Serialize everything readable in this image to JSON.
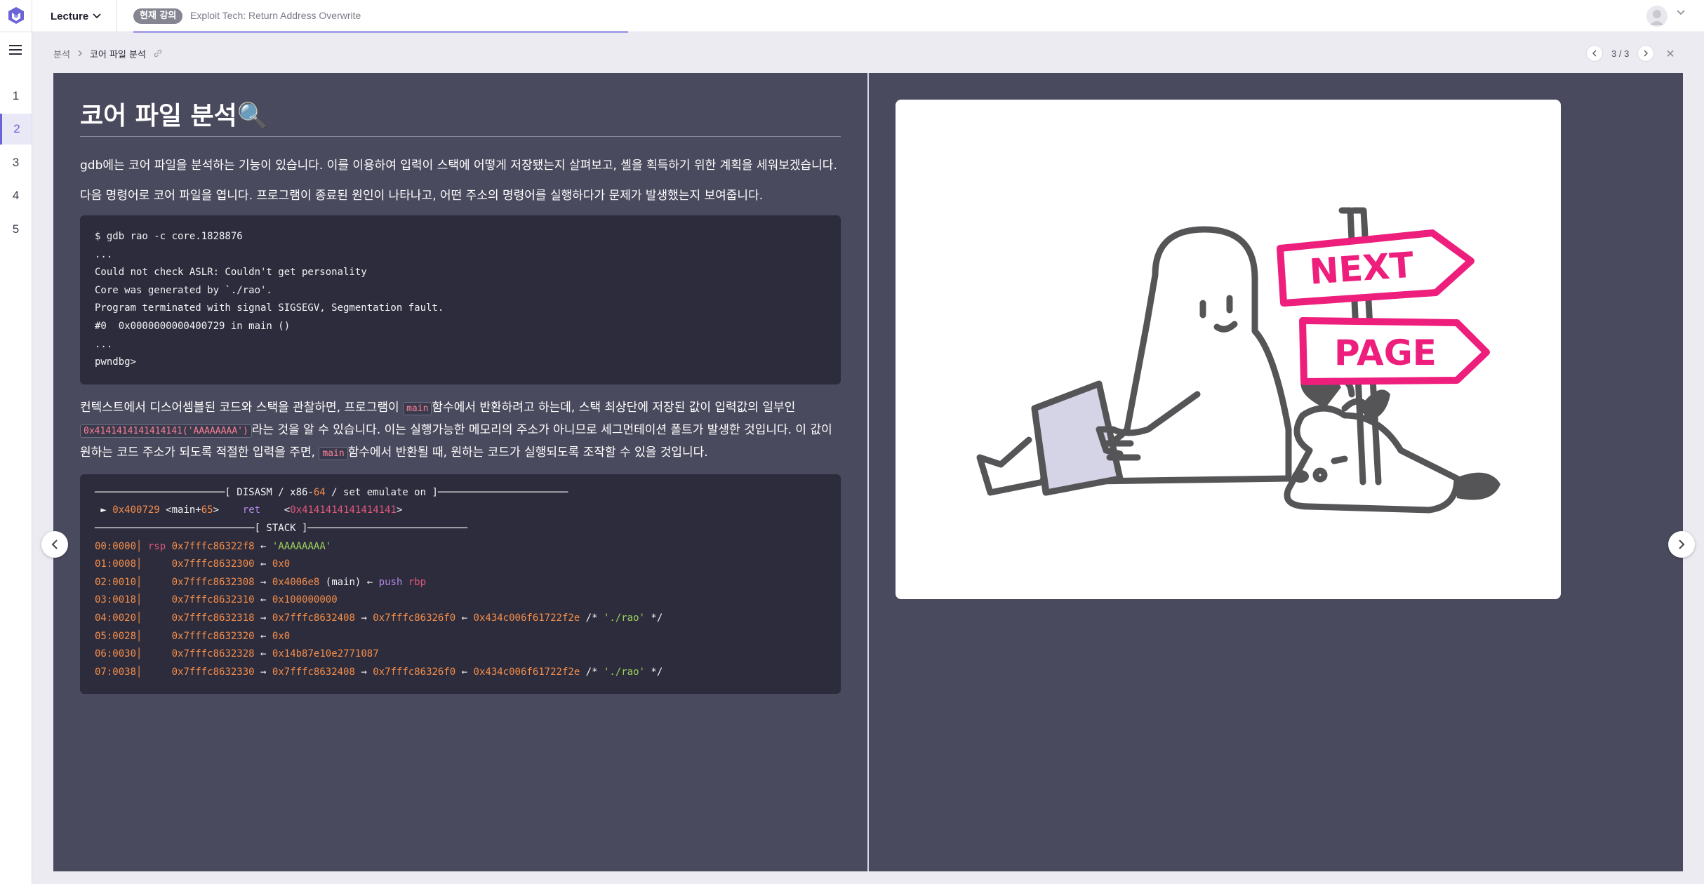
{
  "topbar": {
    "menu_label": "Lecture",
    "current_badge": "현재 강의",
    "course_title": "Exploit Tech: Return Address Overwrite",
    "progress_fraction": 0.45
  },
  "leftnav": {
    "items": [
      "1",
      "2",
      "3",
      "4",
      "5"
    ],
    "active_index": 1
  },
  "breadcrumb": {
    "parent": "분석",
    "current": "코어 파일 분석"
  },
  "pager": {
    "text": "3 / 3"
  },
  "slide": {
    "title": "코어 파일 분석🔍",
    "para1": "gdb에는 코어 파일을 분석하는 기능이 있습니다. 이를 이용하여 입력이 스택에 어떻게 저장됐는지 살펴보고, 셸을 획득하기 위한 계획을 세워보겠습니다.",
    "para2": "다음 명령어로 코어 파일을 엽니다. 프로그램이 종료된 원인이 나타나고, 어떤 주소의 명령어를 실행하다가 문제가 발생했는지 보여줍니다.",
    "code1": [
      "$ gdb rao -c core.1828876",
      "...",
      "Could not check ASLR: Couldn't get personality",
      "Core was generated by `./rao'.",
      "Program terminated with signal SIGSEGV, Segmentation fault.",
      "#0  0x0000000000400729 in main ()",
      "...",
      "pwndbg>"
    ],
    "para3": {
      "t1": "컨텍스트에서 디스어셈블된 코드와 스택을 관찰하면, 프로그램이 ",
      "c1": "main",
      "t2": "함수에서 반환하려고 하는데, 스택 최상단에 저장된 값이 입력값의 일부인 ",
      "c2": "0x4141414141414141('AAAAAAAA')",
      "t3": "라는 것을 알 수 있습니다. 이는 실행가능한 메모리의 주소가 아니므로 세그먼테이션 폴트가 발생한 것입니다. 이 값이 원하는 코드 주소가 되도록 적절한 입력을 주면, ",
      "c3": "main",
      "t4": "함수에서 반환될 때, 원하는 코드가 실행되도록 조작할 수 있을 것입니다."
    },
    "code2": {
      "disasm_header": {
        "left": "──────────────────────[ DISASM / x86-",
        "num": "64",
        "right": " / set emulate on ]──────────────────────"
      },
      "disasm_line": {
        "arrow": " ► ",
        "addr": "0x400729",
        "sym": " <main+",
        "off": "65",
        "sym_end": ">",
        "gap": "    ",
        "op": "ret",
        "gap2": "    <",
        "target": "0x4141414141414141",
        "end": ">"
      },
      "stack_header": "───────────────────────────[ STACK ]───────────────────────────",
      "stack_rows": [
        {
          "idx": "00:0000│",
          "reg": " rsp ",
          "addr": "0x7fffc86322f8",
          "arrow": " ← ",
          "val": "'AAAAAAAA'",
          "val_class": "c-green",
          "rest": []
        },
        {
          "idx": "01:0008│",
          "reg": "     ",
          "addr": "0x7fffc8632300",
          "arrow": " ← ",
          "val": "0x0",
          "val_class": "c-orange",
          "rest": []
        },
        {
          "idx": "02:0010│",
          "reg": "     ",
          "addr": "0x7fffc8632308",
          "arrow": " → ",
          "val": "0x4006e8",
          "val_class": "c-orange",
          "rest": [
            {
              "t": " (main)",
              "c": "c-white"
            },
            {
              "t": " ← ",
              "c": "c-white"
            },
            {
              "t": "push",
              "c": "c-purple"
            },
            {
              "t": " rbp",
              "c": "c-pink"
            }
          ]
        },
        {
          "idx": "03:0018│",
          "reg": "     ",
          "addr": "0x7fffc8632310",
          "arrow": " ← ",
          "val": "0x100000000",
          "val_class": "c-orange",
          "rest": []
        },
        {
          "idx": "04:0020│",
          "reg": "     ",
          "addr": "0x7fffc8632318",
          "arrow": " → ",
          "val": "0x7fffc8632408",
          "val_class": "c-orange",
          "rest": [
            {
              "t": " → ",
              "c": "c-white"
            },
            {
              "t": "0x7fffc86326f0",
              "c": "c-orange"
            },
            {
              "t": " ← ",
              "c": "c-white"
            },
            {
              "t": "0x434c006f61722f2e",
              "c": "c-orange"
            },
            {
              "t": " /* ",
              "c": "c-white"
            },
            {
              "t": "'./rao'",
              "c": "c-green"
            },
            {
              "t": " */",
              "c": "c-white"
            }
          ]
        },
        {
          "idx": "05:0028│",
          "reg": "     ",
          "addr": "0x7fffc8632320",
          "arrow": " ← ",
          "val": "0x0",
          "val_class": "c-orange",
          "rest": []
        },
        {
          "idx": "06:0030│",
          "reg": "     ",
          "addr": "0x7fffc8632328",
          "arrow": " ← ",
          "val": "0x14b87e10e2771087",
          "val_class": "c-orange",
          "rest": []
        },
        {
          "idx": "07:0038│",
          "reg": "     ",
          "addr": "0x7fffc8632330",
          "arrow": " → ",
          "val": "0x7fffc8632408",
          "val_class": "c-orange",
          "rest": [
            {
              "t": " → ",
              "c": "c-white"
            },
            {
              "t": "0x7fffc86326f0",
              "c": "c-orange"
            },
            {
              "t": " ← ",
              "c": "c-white"
            },
            {
              "t": "0x434c006f61722f2e",
              "c": "c-orange"
            },
            {
              "t": " /* ",
              "c": "c-white"
            },
            {
              "t": "'./rao'",
              "c": "c-green"
            },
            {
              "t": " */",
              "c": "c-white"
            }
          ]
        }
      ]
    }
  },
  "illustration": {
    "sign_top": "NEXT",
    "sign_bottom": "PAGE",
    "accent": "#ee1e7d",
    "line_color": "#555558"
  },
  "colors": {
    "panel_bg": "#4a4a5e",
    "code_bg": "#2d2c3c",
    "accent": "#6b63d6"
  }
}
